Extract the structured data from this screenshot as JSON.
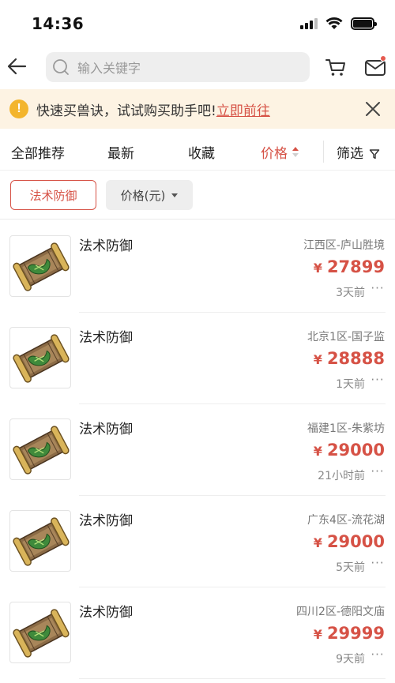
{
  "status_bar": {
    "time": "14:36"
  },
  "header": {
    "search_placeholder": "输入关键字"
  },
  "notice": {
    "text": "快速买兽诀，试试购买助手吧!",
    "link": "立即前往"
  },
  "tabs": [
    {
      "label": "全部推荐",
      "active": false
    },
    {
      "label": "最新",
      "active": false
    },
    {
      "label": "收藏",
      "active": false
    },
    {
      "label": "价格",
      "active": true,
      "sort": "ascending"
    },
    {
      "label": "筛选",
      "active": false
    }
  ],
  "filters": {
    "active_chip": "法术防御",
    "dropdown_label": "价格(元)"
  },
  "listings": [
    {
      "title": "法术防御",
      "server": "江西区-庐山胜境",
      "currency": "¥",
      "price": "27899",
      "time": "3天前"
    },
    {
      "title": "法术防御",
      "server": "北京1区-国子监",
      "currency": "¥",
      "price": "28888",
      "time": "1天前"
    },
    {
      "title": "法术防御",
      "server": "福建1区-朱紫坊",
      "currency": "¥",
      "price": "29000",
      "time": "21小时前"
    },
    {
      "title": "法术防御",
      "server": "广东4区-流花湖",
      "currency": "¥",
      "price": "29000",
      "time": "5天前"
    },
    {
      "title": "法术防御",
      "server": "四川2区-德阳文庙",
      "currency": "¥",
      "price": "29999",
      "time": "9天前"
    }
  ],
  "icons": {
    "back": "arrow-left-icon",
    "search": "search-icon",
    "cart": "cart-icon",
    "message": "mail-icon",
    "notice": "exclamation-icon",
    "close": "close-icon",
    "filter": "funnel-icon",
    "more": "more-dots-icon",
    "item": "scroll-book-icon"
  },
  "colors": {
    "accent": "#d65246",
    "notice_bg": "#fdf3e3",
    "notice_icon": "#f3b52d"
  }
}
